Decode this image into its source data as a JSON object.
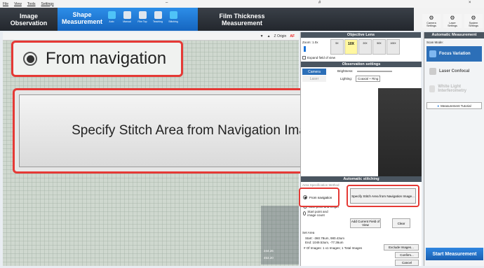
{
  "menubar": {
    "items": [
      "File",
      "View",
      "Tools",
      "Settings"
    ]
  },
  "tabs": {
    "image_observation": "Image\nObservation",
    "shape_measurement": "Shape\nMeasurement",
    "film_thickness": "Film Thickness\nMeasurement"
  },
  "subtabs": [
    "Auto",
    "Manual",
    "Film Top",
    "Teaching",
    "Stitching"
  ],
  "right_tools": [
    "Camera Settings",
    "Laser Settings",
    "System Settings"
  ],
  "viewer": {
    "zoom_origin": "Z Origin",
    "af": "AF",
    "callout_radio_label": "From navigation",
    "callout_button_label": "Specify Stitch Area from Navigation Image...",
    "nav_readouts": [
      "244.26",
      "453.20"
    ]
  },
  "objective": {
    "header": "Objective Lens",
    "zoom_label": "Zoom: 1.0x",
    "lenses": [
      "5X",
      "10X",
      "20X",
      "50X",
      "100X"
    ],
    "selected_lens": "10X",
    "expand_checkbox": "Expand field of view"
  },
  "observation": {
    "header": "Observation settings",
    "camera_btn": "Camera",
    "laser_btn": "Laser",
    "brightness_label": "Brightness:",
    "lighting_label": "Lighting:",
    "lighting_value": "Coaxial + Ring"
  },
  "auto_stitching": {
    "header": "Automatic stitching",
    "area_spec": "Area Specification Method",
    "radio_nav": "From navigation",
    "radio_start_len": "Start point and length",
    "radio_start_count": "Start point and image count",
    "specify_btn": "Specify Stitch Area from Navigation Image...",
    "add_fov_btn": "Add Current Field of View",
    "clear_btn": "Clear",
    "set_area": "Set Area",
    "start": "Start: -360.78um, 980.43um",
    "end": "End: 1049.53um, -77.36um",
    "num_images": "# Of Images: 1 x1 Images; 1 Total Images",
    "exclude_btn": "Exclude Images...",
    "confirm_btn": "Confirm...",
    "cancel_btn": "Cancel"
  },
  "far_panel": {
    "header": "Automatic Measurement",
    "scan_mode": "Scan Mode:",
    "modes": [
      "Focus Variation",
      "Laser Confocal",
      "White Light Interferometry"
    ],
    "tutorial": "Measurement Tutorial",
    "start_btn": "Start Measurement"
  },
  "colors": {
    "accent": "#1a73d9",
    "callout": "#e53935"
  }
}
